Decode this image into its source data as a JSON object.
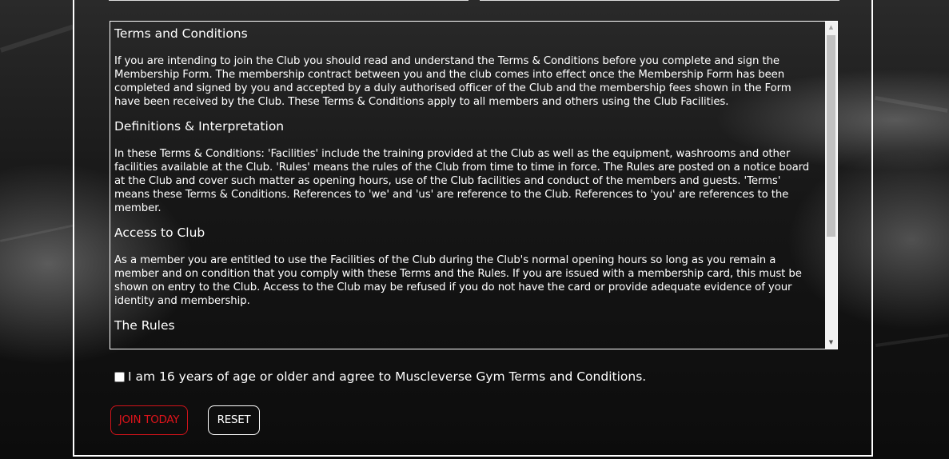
{
  "terms": {
    "sections": [
      {
        "heading": "Terms and Conditions",
        "body": "If you are intending to join the Club you should read and understand the Terms & Conditions before you complete and sign the Membership Form. The membership contract between you and the club comes into effect once the Membership Form has been completed and signed by you and accepted by a duly authorised officer of the Club and the membership fees shown in the Form have been received by the Club. These Terms & Conditions apply to all members and others using the Club Facilities."
      },
      {
        "heading": "Definitions & Interpretation",
        "body": "In these Terms & Conditions: 'Facilities' include the training provided at the Club as well as the equipment, washrooms and other facilities available at the Club. 'Rules' means the rules of the Club from time to time in force. The Rules are posted on a notice board at the Club and cover such matter as opening hours, use of the Club facilities and conduct of the members and guests. 'Terms' means these Terms & Conditions. References to 'we' and 'us' are reference to the Club. References to 'you' are references to the member."
      },
      {
        "heading": "Access to Club",
        "body": "As a member you are entitled to use the Facilities of the Club during the Club's normal opening hours so long as you remain a member and on condition that you comply with these Terms and the Rules. If you are issued with a membership card, this must be shown on entry to the Club. Access to the Club may be refused if you do not have the card or provide adequate evidence of your identity and membership."
      },
      {
        "heading": "The Rules",
        "body": ""
      }
    ],
    "scroll_up_icon": "triangle-up-icon",
    "scroll_down_icon": "triangle-down-icon"
  },
  "agreement": {
    "label": "I am 16 years of age or older and agree to Muscleverse Gym Terms and Conditions.",
    "checked": false
  },
  "buttons": {
    "join_label": "JOIN TODAY",
    "reset_label": "RESET"
  },
  "colors": {
    "accent_red": "#e0141b",
    "text_white": "#ffffff"
  }
}
